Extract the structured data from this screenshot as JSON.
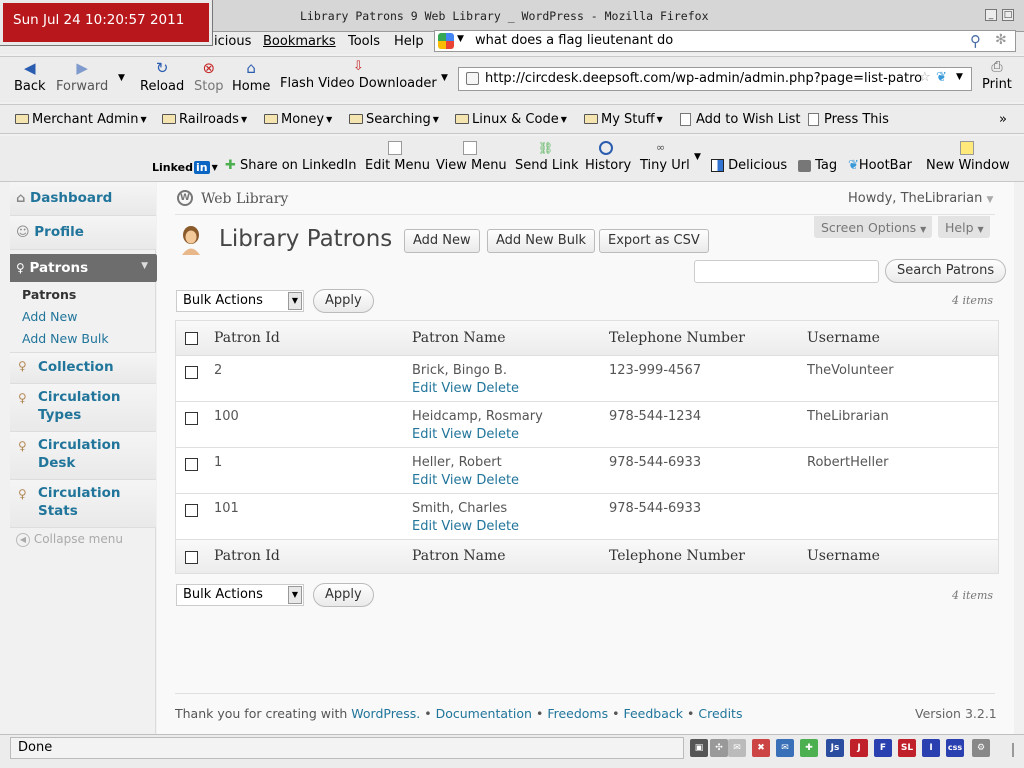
{
  "clock": "Sun Jul 24 10:20:57 2011",
  "window_title": "Library Patrons  9 Web Library  _ WordPress - Mozilla Firefox",
  "menus": [
    "icious",
    "Bookmarks",
    "Tools",
    "Help"
  ],
  "search_query": "what does a flag lieutenant do",
  "nav": {
    "back": "Back",
    "forward": "Forward",
    "reload": "Reload",
    "stop": "Stop",
    "home": "Home",
    "flash": "Flash Video Downloader",
    "print": "Print"
  },
  "url": "http://circdesk.deepsoft.com/wp-admin/admin.php?page=list-patro",
  "bookmarks": [
    "Merchant Admin",
    "Railroads",
    "Money",
    "Searching",
    "Linux & Code",
    "My Stuff",
    "Add to Wish List",
    "Press This"
  ],
  "linkedin": {
    "logo_text": "Linked",
    "logo_badge": "in",
    "share": "Share on LinkedIn",
    "edit_menu": "Edit Menu",
    "view_menu": "View Menu",
    "send_link": "Send Link",
    "history": "History",
    "tiny_url": "Tiny Url",
    "delicious": "Delicious",
    "tag": "Tag",
    "hootbar": "HootBar",
    "new_window": "New Window"
  },
  "sidebar": {
    "dashboard": "Dashboard",
    "profile": "Profile",
    "patrons": "Patrons",
    "sub": [
      "Patrons",
      "Add New",
      "Add New Bulk"
    ],
    "collection": "Collection",
    "circ_types": "Circulation Types",
    "circ_desk": "Circulation Desk",
    "circ_stats": "Circulation Stats",
    "collapse": "Collapse menu"
  },
  "header": {
    "site": "Web Library",
    "howdy": "Howdy, TheLibrarian",
    "screen_options": "Screen Options",
    "help": "Help"
  },
  "page": {
    "title": "Library Patrons",
    "add_new": "Add New",
    "add_new_bulk": "Add New Bulk",
    "export": "Export as CSV",
    "search_button": "Search Patrons",
    "bulk_actions": "Bulk Actions",
    "apply": "Apply",
    "items": "4 items"
  },
  "table": {
    "columns": [
      "Patron Id",
      "Patron Name",
      "Telephone Number",
      "Username"
    ],
    "row_actions": [
      "Edit",
      "View",
      "Delete"
    ],
    "rows": [
      {
        "id": "2",
        "name": "Brick, Bingo B.",
        "phone": "123-999-4567",
        "username": "TheVolunteer"
      },
      {
        "id": "100",
        "name": "Heidcamp, Rosmary",
        "phone": "978-544-1234",
        "username": "TheLibrarian"
      },
      {
        "id": "1",
        "name": "Heller, Robert",
        "phone": "978-544-6933",
        "username": "RobertHeller"
      },
      {
        "id": "101",
        "name": "Smith, Charles",
        "phone": "978-544-6933",
        "username": ""
      }
    ]
  },
  "footer": {
    "thanks": "Thank you for creating with",
    "wordpress": "WordPress.",
    "sep": "•",
    "documentation": "Documentation",
    "freedoms": "Freedoms",
    "feedback": "Feedback",
    "credits": "Credits",
    "version": "Version 3.2.1"
  },
  "status": "Done",
  "status_icons": [
    "Js",
    "J",
    "F",
    "SL",
    "I",
    "css"
  ],
  "colors": {
    "wp_link": "#21759b",
    "clock_bg": "#b8171c",
    "sidebar_active": "#6d6d6d"
  }
}
